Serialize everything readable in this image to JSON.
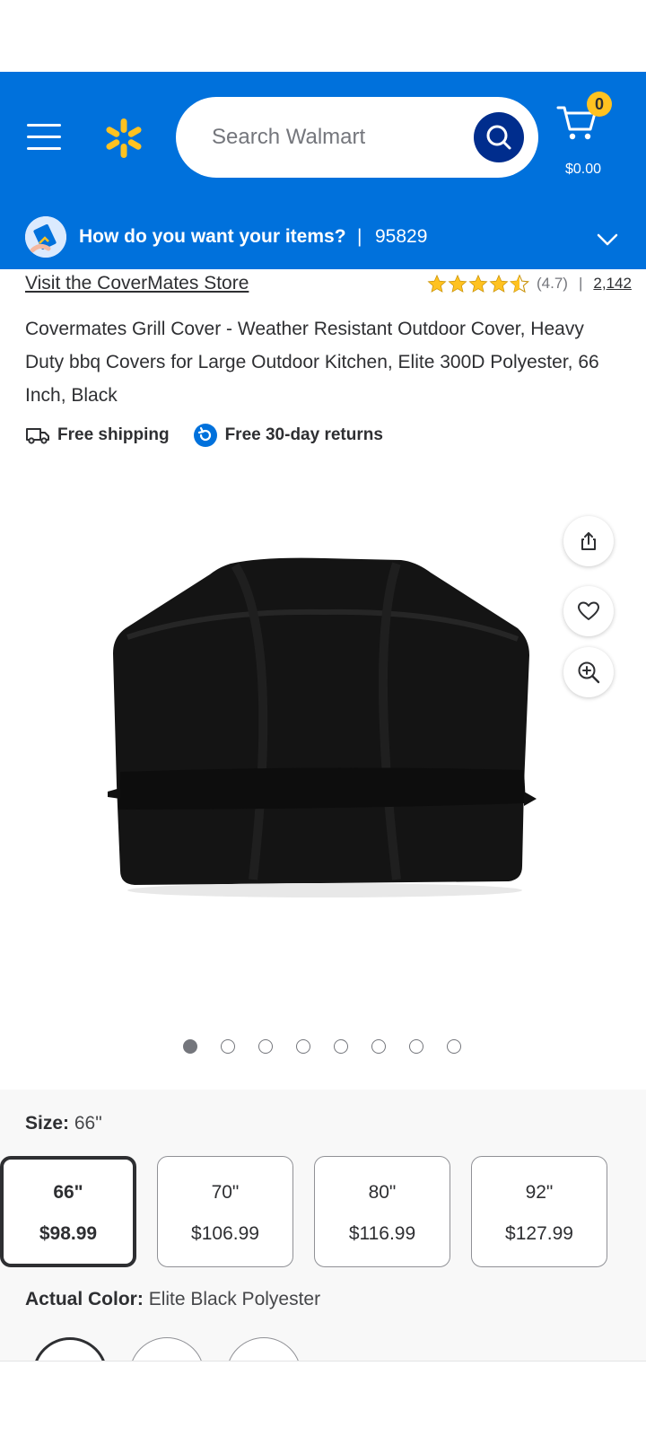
{
  "header": {
    "search_placeholder": "Search Walmart",
    "cart_count": "0",
    "cart_total": "$0.00"
  },
  "delivery": {
    "prompt": "How do you want your items?",
    "separator": "|",
    "zip": "95829"
  },
  "product": {
    "store_link": "Visit the CoverMates Store",
    "rating_value": "(4.7)",
    "rating_separator": "|",
    "review_count": "2,142",
    "stars": 4.5,
    "title": "Covermates Grill Cover - Weather Resistant Outdoor Cover, Heavy Duty bbq Covers for Large Outdoor Kitchen, Elite 300D Polyester, 66 Inch, Black",
    "perks": {
      "shipping": "Free shipping",
      "returns": "Free 30-day returns"
    },
    "image_count": 8,
    "current_image": 1
  },
  "variants": {
    "size_label": "Size:",
    "size_value": "66\"",
    "sizes": [
      {
        "name": "66\"",
        "price": "$98.99",
        "selected": true
      },
      {
        "name": "70\"",
        "price": "$106.99",
        "selected": false
      },
      {
        "name": "80\"",
        "price": "$116.99",
        "selected": false
      },
      {
        "name": "92\"",
        "price": "$127.99",
        "selected": false
      }
    ],
    "color_label": "Actual Color:",
    "color_value": "Elite Black Polyester"
  },
  "colors": {
    "brand_blue": "#0071dc",
    "search_btn": "#002d8d",
    "spark_yellow": "#ffc220",
    "star": "#ffc220"
  },
  "icons": [
    "menu-icon",
    "spark-logo-icon",
    "search-icon",
    "cart-icon",
    "chevron-down-icon",
    "truck-icon",
    "returns-icon",
    "share-icon",
    "heart-icon",
    "zoom-in-icon",
    "star-icon"
  ]
}
